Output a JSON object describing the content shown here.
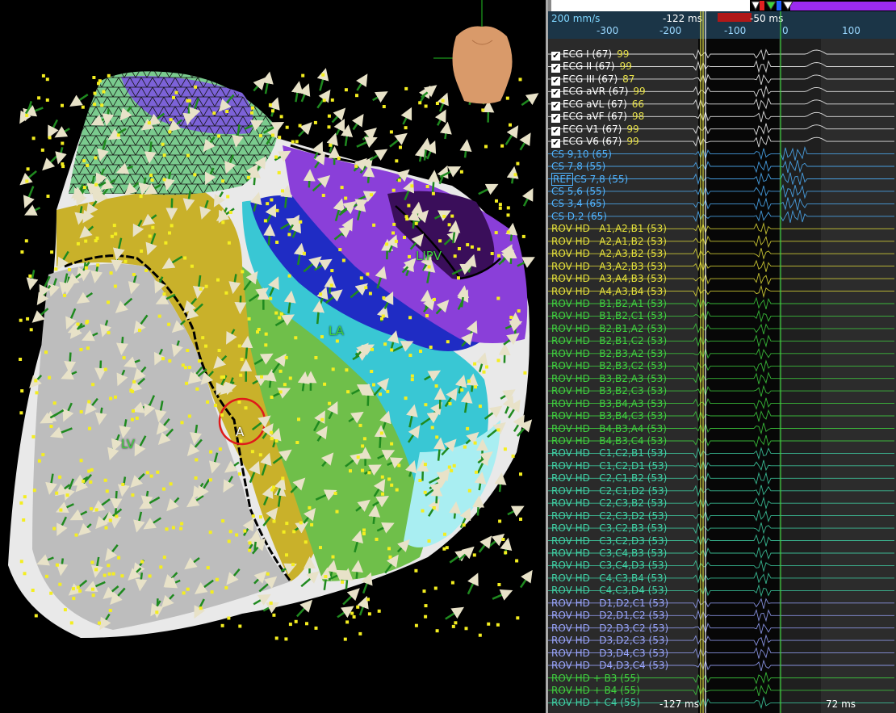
{
  "map": {
    "labels": [
      {
        "id": "lipv",
        "text": "LIPV"
      },
      {
        "id": "la",
        "text": "LA"
      },
      {
        "id": "lv",
        "text": "LV"
      },
      {
        "id": "a",
        "text": "A"
      }
    ]
  },
  "timebar": {
    "speed": "200 mm/s",
    "marker_left": "-122 ms",
    "marker_right": "-50 ms",
    "ticks": [
      "-300",
      "-200",
      "-100",
      "0",
      "100"
    ]
  },
  "readouts": {
    "left": "-127 ms",
    "right": "72 ms"
  },
  "channels": [
    {
      "label": "ECG I (67)",
      "value": "99",
      "color": "#ffffff",
      "checked": true
    },
    {
      "label": "ECG II (67)",
      "value": "99",
      "color": "#ffffff",
      "checked": true
    },
    {
      "label": "ECG III (67)",
      "value": "87",
      "color": "#ffffff",
      "checked": true
    },
    {
      "label": "ECG aVR (67)",
      "value": "99",
      "color": "#ffffff",
      "checked": true
    },
    {
      "label": "ECG aVL (67)",
      "value": "66",
      "color": "#ffffff",
      "checked": true
    },
    {
      "label": "ECG aVF (67)",
      "value": "98",
      "color": "#ffffff",
      "checked": true
    },
    {
      "label": "ECG V1 (67)",
      "value": "99",
      "color": "#ffffff",
      "checked": true
    },
    {
      "label": "ECG V6 (67)",
      "value": "99",
      "color": "#ffffff",
      "checked": true
    },
    {
      "label": "CS 9,10 (65)",
      "value": "",
      "color": "#4fb3ff",
      "checked": false
    },
    {
      "label": "CS 7,8 (55)",
      "value": "",
      "color": "#4fb3ff",
      "checked": false
    },
    {
      "label": "CS 7,8 (55)",
      "value": "",
      "color": "#4fb3ff",
      "checked": false,
      "ref": "REF"
    },
    {
      "label": "CS 5,6 (55)",
      "value": "",
      "color": "#4fb3ff",
      "checked": false
    },
    {
      "label": "CS 3,4 (65)",
      "value": "",
      "color": "#4fb3ff",
      "checked": false
    },
    {
      "label": "CS D,2 (65)",
      "value": "",
      "color": "#4fb3ff",
      "checked": false
    },
    {
      "label": "ROV HD   A1,A2,B1 (53)",
      "value": "",
      "color": "#e6e23a",
      "checked": false
    },
    {
      "label": "ROV HD   A2,A1,B2 (53)",
      "value": "",
      "color": "#e6e23a",
      "checked": false
    },
    {
      "label": "ROV HD   A2,A3,B2 (53)",
      "value": "",
      "color": "#e6e23a",
      "checked": false
    },
    {
      "label": "ROV HD   A3,A2,B3 (53)",
      "value": "",
      "color": "#e6e23a",
      "checked": false
    },
    {
      "label": "ROV HD   A3,A4,B3 (53)",
      "value": "",
      "color": "#e6e23a",
      "checked": false
    },
    {
      "label": "ROV HD   A4,A3,B4 (53)",
      "value": "",
      "color": "#e6e23a",
      "checked": false
    },
    {
      "label": "ROV HD   B1,B2,A1 (53)",
      "value": "",
      "color": "#3fd23f",
      "checked": false
    },
    {
      "label": "ROV HD   B1,B2,C1 (53)",
      "value": "",
      "color": "#3fd23f",
      "checked": false
    },
    {
      "label": "ROV HD   B2,B1,A2 (53)",
      "value": "",
      "color": "#3fd23f",
      "checked": false
    },
    {
      "label": "ROV HD   B2,B1,C2 (53)",
      "value": "",
      "color": "#3fd23f",
      "checked": false
    },
    {
      "label": "ROV HD   B2,B3,A2 (53)",
      "value": "",
      "color": "#3fd23f",
      "checked": false
    },
    {
      "label": "ROV HD   B2,B3,C2 (53)",
      "value": "",
      "color": "#3fd23f",
      "checked": false
    },
    {
      "label": "ROV HD   B3,B2,A3 (53)",
      "value": "",
      "color": "#3fd23f",
      "checked": false
    },
    {
      "label": "ROV HD   B3,B2,C3 (53)",
      "value": "",
      "color": "#3fd23f",
      "checked": false
    },
    {
      "label": "ROV HD   B3,B4,A3 (53)",
      "value": "",
      "color": "#3fd23f",
      "checked": false
    },
    {
      "label": "ROV HD   B3,B4,C3 (53)",
      "value": "",
      "color": "#3fd23f",
      "checked": false
    },
    {
      "label": "ROV HD   B4,B3,A4 (53)",
      "value": "",
      "color": "#3fd23f",
      "checked": false
    },
    {
      "label": "ROV HD   B4,B3,C4 (53)",
      "value": "",
      "color": "#3fd23f",
      "checked": false
    },
    {
      "label": "ROV HD   C1,C2,B1 (53)",
      "value": "",
      "color": "#3fd2a6",
      "checked": false
    },
    {
      "label": "ROV HD   C1,C2,D1 (53)",
      "value": "",
      "color": "#3fd2a6",
      "checked": false
    },
    {
      "label": "ROV HD   C2,C1,B2 (53)",
      "value": "",
      "color": "#3fd2a6",
      "checked": false
    },
    {
      "label": "ROV HD   C2,C1,D2 (53)",
      "value": "",
      "color": "#3fd2a6",
      "checked": false
    },
    {
      "label": "ROV HD   C2,C3,B2 (53)",
      "value": "",
      "color": "#3fd2a6",
      "checked": false
    },
    {
      "label": "ROV HD   C2,C3,D2 (53)",
      "value": "",
      "color": "#3fd2a6",
      "checked": false
    },
    {
      "label": "ROV HD   C3,C2,B3 (53)",
      "value": "",
      "color": "#3fd2a6",
      "checked": false
    },
    {
      "label": "ROV HD   C3,C2,D3 (53)",
      "value": "",
      "color": "#3fd2a6",
      "checked": false
    },
    {
      "label": "ROV HD   C3,C4,B3 (53)",
      "value": "",
      "color": "#3fd2a6",
      "checked": false
    },
    {
      "label": "ROV HD   C3,C4,D3 (53)",
      "value": "",
      "color": "#3fd2a6",
      "checked": false
    },
    {
      "label": "ROV HD   C4,C3,B4 (53)",
      "value": "",
      "color": "#3fd2a6",
      "checked": false
    },
    {
      "label": "ROV HD   C4,C3,D4 (53)",
      "value": "",
      "color": "#3fd2a6",
      "checked": false
    },
    {
      "label": "ROV HD   D1,D2,C1 (53)",
      "value": "",
      "color": "#9aa6ff",
      "checked": false
    },
    {
      "label": "ROV HD   D2,D1,C2 (53)",
      "value": "",
      "color": "#9aa6ff",
      "checked": false
    },
    {
      "label": "ROV HD   D2,D3,C2 (53)",
      "value": "",
      "color": "#9aa6ff",
      "checked": false
    },
    {
      "label": "ROV HD   D3,D2,C3 (53)",
      "value": "",
      "color": "#9aa6ff",
      "checked": false
    },
    {
      "label": "ROV HD   D3,D4,C3 (53)",
      "value": "",
      "color": "#9aa6ff",
      "checked": false
    },
    {
      "label": "ROV HD   D4,D3,C4 (53)",
      "value": "",
      "color": "#9aa6ff",
      "checked": false
    },
    {
      "label": "ROV HD + B3 (55)",
      "value": "",
      "color": "#3fd23f",
      "checked": false
    },
    {
      "label": "ROV HD + B4 (55)",
      "value": "",
      "color": "#3fd23f",
      "checked": false
    },
    {
      "label": "ROV HD + C4 (55)",
      "value": "",
      "color": "#3fd2a6",
      "checked": false
    }
  ]
}
